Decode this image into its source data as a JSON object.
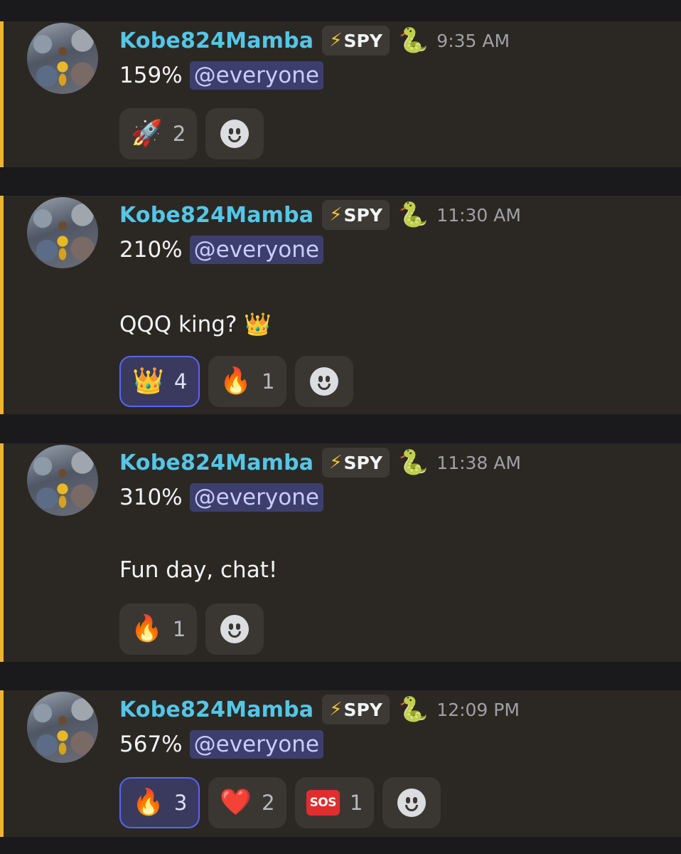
{
  "messages": [
    {
      "username": "Kobe824Mamba",
      "tag": "SPY",
      "time": "9:35 AM",
      "line1": "159%",
      "mention": "@everyone",
      "line2": "",
      "reactions": [
        {
          "emoji": "🚀",
          "count": "2",
          "active": false
        }
      ]
    },
    {
      "username": "Kobe824Mamba",
      "tag": "SPY",
      "time": "11:30 AM",
      "line1": "210%",
      "mention": "@everyone",
      "line2": "QQQ king? 👑",
      "reactions": [
        {
          "emoji": "👑",
          "count": "4",
          "active": true
        },
        {
          "emoji": "🔥",
          "count": "1",
          "active": false
        }
      ]
    },
    {
      "username": "Kobe824Mamba",
      "tag": "SPY",
      "time": "11:38 AM",
      "line1": "310%",
      "mention": "@everyone",
      "line2": "Fun day, chat!",
      "reactions": [
        {
          "emoji": "🔥",
          "count": "1",
          "active": false
        }
      ]
    },
    {
      "username": "Kobe824Mamba",
      "tag": "SPY",
      "time": "12:09 PM",
      "line1": "567%",
      "mention": "@everyone",
      "line2": "",
      "reactions": [
        {
          "emoji": "🔥",
          "count": "3",
          "active": true
        },
        {
          "emoji": "❤️",
          "count": "2",
          "active": false
        },
        {
          "emoji": "SOS",
          "count": "1",
          "active": false
        }
      ]
    }
  ],
  "icons": {
    "tag_icon": "lightning-bolt-icon",
    "role_icon": "snake-emoji-icon",
    "add_reaction_icon": "smiley-face-icon"
  },
  "colors": {
    "username": "#54c6e7",
    "mention_bg": "#3c3f6e",
    "accent_bar": "#f0b232",
    "active_reaction_border": "#5865f2"
  }
}
